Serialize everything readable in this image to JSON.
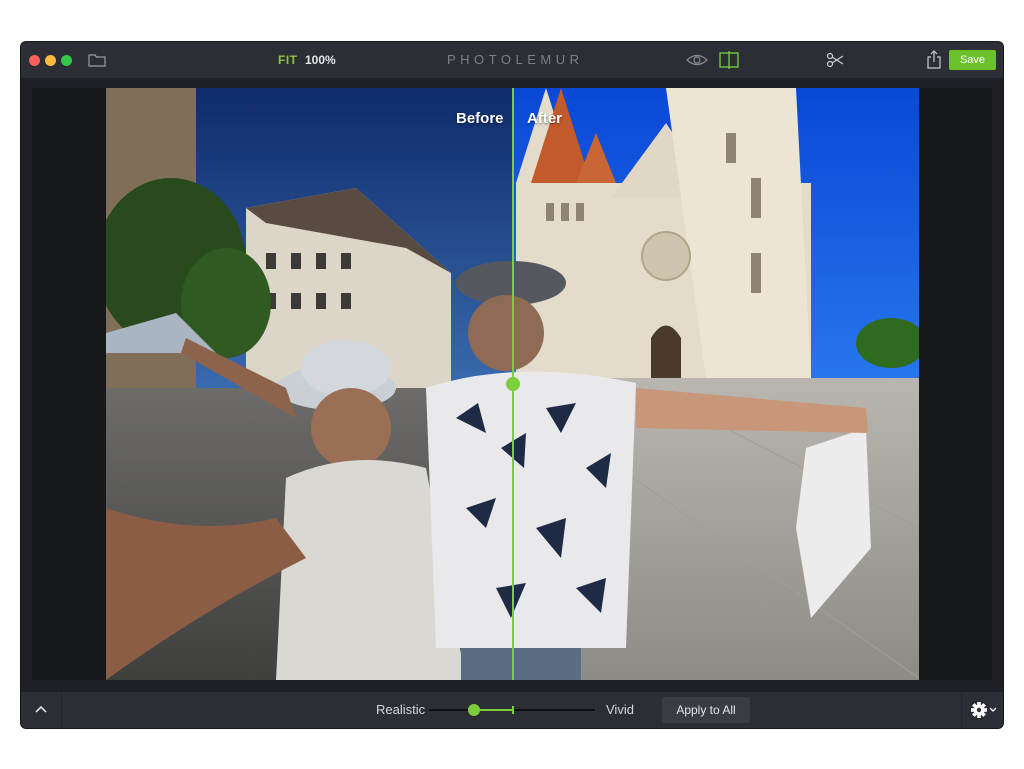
{
  "titlebar": {
    "fit_label": "FIT",
    "zoom_label": "100%",
    "app_title": "PHOTOLEMUR",
    "save_label": "Save",
    "icons": [
      "close-dot",
      "minimize-dot",
      "zoom-dot",
      "folder-icon",
      "eye-icon",
      "compare-icon",
      "scissors-icon",
      "share-icon"
    ]
  },
  "canvas": {
    "before_label": "Before",
    "after_label": "After",
    "comparison_split": 0.5
  },
  "bottombar": {
    "realistic_label": "Realistic",
    "vivid_label": "Vivid",
    "apply_label": "Apply to All",
    "intensity": 0.27,
    "icons": [
      "chevron-up-icon",
      "gear-icon",
      "chevron-down-icon"
    ]
  },
  "colors": {
    "accent": "#7dce3c",
    "save": "#6bc12b",
    "window": "#1e2026",
    "bar": "#2c2e35"
  }
}
